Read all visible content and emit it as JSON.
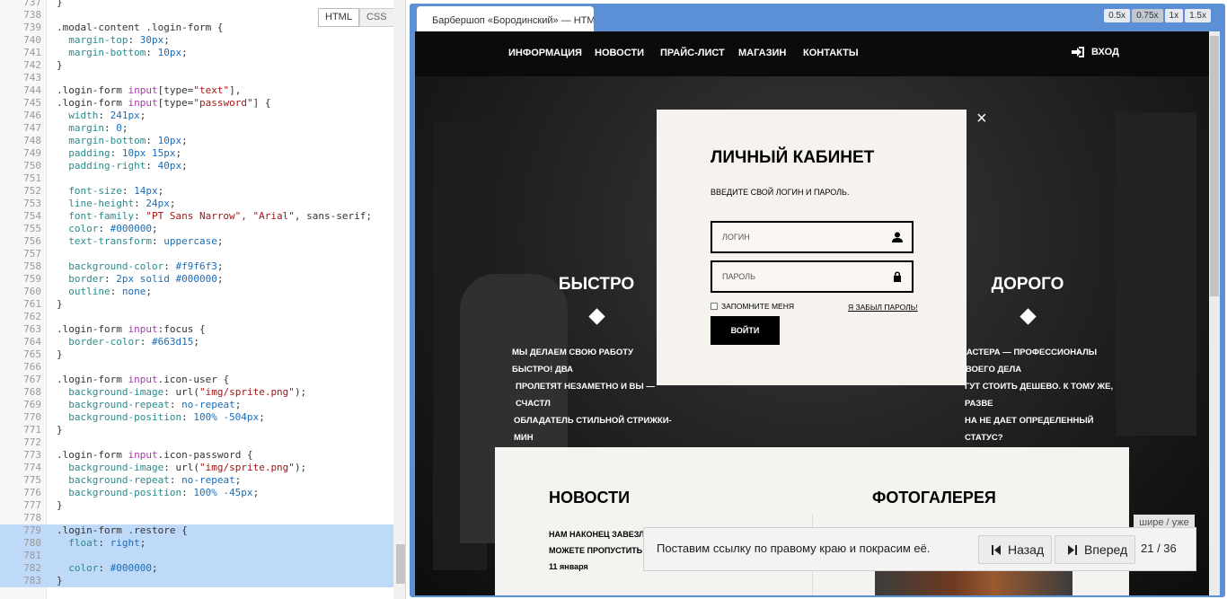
{
  "editor": {
    "toggle": {
      "html": "HTML",
      "css": "CSS"
    },
    "lines": [
      {
        "n": "737",
        "segs": [
          [
            "}",
            "t-sel"
          ]
        ]
      },
      {
        "n": "738",
        "segs": []
      },
      {
        "n": "739",
        "segs": [
          [
            ".modal-content .login-form {",
            "t-sel"
          ]
        ]
      },
      {
        "n": "740",
        "segs": [
          [
            "  margin-top",
            "t-prop"
          ],
          [
            ": ",
            "t-sel"
          ],
          [
            "30px",
            "t-num"
          ],
          [
            ";",
            "t-sel"
          ]
        ]
      },
      {
        "n": "741",
        "segs": [
          [
            "  margin-bottom",
            "t-prop"
          ],
          [
            ": ",
            "t-sel"
          ],
          [
            "10px",
            "t-num"
          ],
          [
            ";",
            "t-sel"
          ]
        ]
      },
      {
        "n": "742",
        "segs": [
          [
            "}",
            "t-sel"
          ]
        ]
      },
      {
        "n": "743",
        "segs": []
      },
      {
        "n": "744",
        "segs": [
          [
            ".login-form ",
            "t-sel"
          ],
          [
            "input",
            "t-tag"
          ],
          [
            "[type=",
            "t-sel"
          ],
          [
            "\"text\"",
            "t-str"
          ],
          [
            "],",
            "t-sel"
          ]
        ]
      },
      {
        "n": "745",
        "segs": [
          [
            ".login-form ",
            "t-sel"
          ],
          [
            "input",
            "t-tag"
          ],
          [
            "[type=",
            "t-sel"
          ],
          [
            "\"password\"",
            "t-str"
          ],
          [
            "] {",
            "t-sel"
          ]
        ]
      },
      {
        "n": "746",
        "segs": [
          [
            "  width",
            "t-prop"
          ],
          [
            ": ",
            "t-sel"
          ],
          [
            "241px",
            "t-num"
          ],
          [
            ";",
            "t-sel"
          ]
        ]
      },
      {
        "n": "747",
        "segs": [
          [
            "  margin",
            "t-prop"
          ],
          [
            ": ",
            "t-sel"
          ],
          [
            "0",
            "t-num"
          ],
          [
            ";",
            "t-sel"
          ]
        ]
      },
      {
        "n": "748",
        "segs": [
          [
            "  margin-bottom",
            "t-prop"
          ],
          [
            ": ",
            "t-sel"
          ],
          [
            "10px",
            "t-num"
          ],
          [
            ";",
            "t-sel"
          ]
        ]
      },
      {
        "n": "749",
        "segs": [
          [
            "  padding",
            "t-prop"
          ],
          [
            ": ",
            "t-sel"
          ],
          [
            "10px 15px",
            "t-num"
          ],
          [
            ";",
            "t-sel"
          ]
        ]
      },
      {
        "n": "750",
        "segs": [
          [
            "  padding-right",
            "t-prop"
          ],
          [
            ": ",
            "t-sel"
          ],
          [
            "40px",
            "t-num"
          ],
          [
            ";",
            "t-sel"
          ]
        ]
      },
      {
        "n": "751",
        "segs": []
      },
      {
        "n": "752",
        "segs": [
          [
            "  font-size",
            "t-prop"
          ],
          [
            ": ",
            "t-sel"
          ],
          [
            "14px",
            "t-num"
          ],
          [
            ";",
            "t-sel"
          ]
        ]
      },
      {
        "n": "753",
        "segs": [
          [
            "  line-height",
            "t-prop"
          ],
          [
            ": ",
            "t-sel"
          ],
          [
            "24px",
            "t-num"
          ],
          [
            ";",
            "t-sel"
          ]
        ]
      },
      {
        "n": "754",
        "segs": [
          [
            "  font-family",
            "t-prop"
          ],
          [
            ": ",
            "t-sel"
          ],
          [
            "\"PT Sans Narrow\", \"Arial\"",
            "t-str"
          ],
          [
            ", sans-serif;",
            "t-sel"
          ]
        ]
      },
      {
        "n": "755",
        "segs": [
          [
            "  color",
            "t-prop"
          ],
          [
            ": ",
            "t-sel"
          ],
          [
            "#000000",
            "t-num"
          ],
          [
            ";",
            "t-sel"
          ]
        ]
      },
      {
        "n": "756",
        "segs": [
          [
            "  text-transform",
            "t-prop"
          ],
          [
            ": ",
            "t-sel"
          ],
          [
            "uppercase",
            "t-kw"
          ],
          [
            ";",
            "t-sel"
          ]
        ]
      },
      {
        "n": "757",
        "segs": []
      },
      {
        "n": "758",
        "segs": [
          [
            "  background-color",
            "t-prop"
          ],
          [
            ": ",
            "t-sel"
          ],
          [
            "#f9f6f3",
            "t-num"
          ],
          [
            ";",
            "t-sel"
          ]
        ]
      },
      {
        "n": "759",
        "segs": [
          [
            "  border",
            "t-prop"
          ],
          [
            ": ",
            "t-sel"
          ],
          [
            "2px solid #000000",
            "t-num"
          ],
          [
            ";",
            "t-sel"
          ]
        ]
      },
      {
        "n": "760",
        "segs": [
          [
            "  outline",
            "t-prop"
          ],
          [
            ": ",
            "t-sel"
          ],
          [
            "none",
            "t-kw"
          ],
          [
            ";",
            "t-sel"
          ]
        ]
      },
      {
        "n": "761",
        "segs": [
          [
            "}",
            "t-sel"
          ]
        ]
      },
      {
        "n": "762",
        "segs": []
      },
      {
        "n": "763",
        "segs": [
          [
            ".login-form ",
            "t-sel"
          ],
          [
            "input",
            "t-tag"
          ],
          [
            ":focus {",
            "t-sel"
          ]
        ]
      },
      {
        "n": "764",
        "segs": [
          [
            "  border-color",
            "t-prop"
          ],
          [
            ": ",
            "t-sel"
          ],
          [
            "#663d15",
            "t-num"
          ],
          [
            ";",
            "t-sel"
          ]
        ]
      },
      {
        "n": "765",
        "segs": [
          [
            "}",
            "t-sel"
          ]
        ]
      },
      {
        "n": "766",
        "segs": []
      },
      {
        "n": "767",
        "segs": [
          [
            ".login-form ",
            "t-sel"
          ],
          [
            "input",
            "t-tag"
          ],
          [
            ".icon-user {",
            "t-sel"
          ]
        ]
      },
      {
        "n": "768",
        "segs": [
          [
            "  background-image",
            "t-prop"
          ],
          [
            ": url(",
            "t-sel"
          ],
          [
            "\"img/sprite.png\"",
            "t-str"
          ],
          [
            ");",
            "t-sel"
          ]
        ]
      },
      {
        "n": "769",
        "segs": [
          [
            "  background-repeat",
            "t-prop"
          ],
          [
            ": ",
            "t-sel"
          ],
          [
            "no-repeat",
            "t-kw"
          ],
          [
            ";",
            "t-sel"
          ]
        ]
      },
      {
        "n": "770",
        "segs": [
          [
            "  background-position",
            "t-prop"
          ],
          [
            ": ",
            "t-sel"
          ],
          [
            "100% -504px",
            "t-num"
          ],
          [
            ";",
            "t-sel"
          ]
        ]
      },
      {
        "n": "771",
        "segs": [
          [
            "}",
            "t-sel"
          ]
        ]
      },
      {
        "n": "772",
        "segs": []
      },
      {
        "n": "773",
        "segs": [
          [
            ".login-form ",
            "t-sel"
          ],
          [
            "input",
            "t-tag"
          ],
          [
            ".icon-password {",
            "t-sel"
          ]
        ]
      },
      {
        "n": "774",
        "segs": [
          [
            "  background-image",
            "t-prop"
          ],
          [
            ": url(",
            "t-sel"
          ],
          [
            "\"img/sprite.png\"",
            "t-str"
          ],
          [
            ");",
            "t-sel"
          ]
        ]
      },
      {
        "n": "775",
        "segs": [
          [
            "  background-repeat",
            "t-prop"
          ],
          [
            ": ",
            "t-sel"
          ],
          [
            "no-repeat",
            "t-kw"
          ],
          [
            ";",
            "t-sel"
          ]
        ]
      },
      {
        "n": "776",
        "segs": [
          [
            "  background-position",
            "t-prop"
          ],
          [
            ": ",
            "t-sel"
          ],
          [
            "100% -45px",
            "t-num"
          ],
          [
            ";",
            "t-sel"
          ]
        ]
      },
      {
        "n": "777",
        "segs": [
          [
            "}",
            "t-sel"
          ]
        ]
      },
      {
        "n": "778",
        "segs": []
      },
      {
        "n": "779",
        "segs": [
          [
            ".login-form .restore {",
            "t-sel"
          ]
        ],
        "hl": true
      },
      {
        "n": "780",
        "segs": [
          [
            "  float",
            "t-prop"
          ],
          [
            ": ",
            "t-sel"
          ],
          [
            "right",
            "t-kw"
          ],
          [
            ";",
            "t-sel"
          ]
        ],
        "hl": true
      },
      {
        "n": "781",
        "segs": [],
        "hl": true
      },
      {
        "n": "782",
        "segs": [
          [
            "  color",
            "t-prop"
          ],
          [
            ": ",
            "t-sel"
          ],
          [
            "#000000",
            "t-num"
          ],
          [
            ";",
            "t-sel"
          ]
        ],
        "hl": true
      },
      {
        "n": "783",
        "segs": [
          [
            "}",
            "t-sel"
          ]
        ],
        "hl": true
      }
    ]
  },
  "preview": {
    "tab_title": "Барбершоп «Бородинский» — HTML",
    "zoom": [
      "0.5x",
      "0.75x",
      "1x",
      "1.5x"
    ],
    "zoom_active": "0.75x"
  },
  "site": {
    "nav": [
      "ИНФОРМАЦИЯ",
      "НОВОСТИ",
      "ПРАЙС-ЛИСТ",
      "МАГАЗИН",
      "КОНТАКТЫ"
    ],
    "login": "ВХОД",
    "features": {
      "left_title": "БЫСТРО",
      "right_title": "ДОРОГО",
      "left_text": [
        "МЫ ДЕЛАЕМ СВОЮ РАБОТУ БЫСТРО! ДВА",
        "ПРОЛЕТЯТ НЕЗАМЕТНО И ВЫ — СЧАСТЛ",
        "ОБЛАДАТЕЛЬ СТИЛЬНОЙ СТРИЖКИ-МИН"
      ],
      "right_text": [
        "МАСТЕРА — ПРОФЕССИОНАЛЫ СВОЕГО ДЕЛА",
        "ГУТ СТОИТЬ ДЕШЕВО. К ТОМУ ЖЕ, РАЗВЕ",
        "НА НЕ ДАЕТ ОПРЕДЕЛЕННЫЙ СТАТУС?"
      ]
    },
    "news": {
      "title": "НОВОСТИ",
      "text": "НАМ НАКОНЕЦ ЗАВЕЗЛИ ЯГЕРМАЙСТЕР! ТЕПЕРЬ ВЫ МОЖЕТЕ ПРОПУСТИТЬ СТАКАНЧИК В",
      "date": "11 января"
    },
    "gallery": {
      "title": "ФОТОГАЛЕРЕЯ"
    }
  },
  "modal": {
    "title": "ЛИЧНЫЙ КАБИНЕТ",
    "subtitle": "ВВЕДИТЕ СВОЙ ЛОГИН И ПАРОЛЬ.",
    "login_placeholder": "ЛОГИН",
    "password_placeholder": "ПАРОЛЬ",
    "remember": "ЗАПОМНИТЕ МЕНЯ",
    "forgot": "Я ЗАБЫЛ ПАРОЛЬ!",
    "submit": "ВОЙТИ",
    "close": "×"
  },
  "tutorial": {
    "hint_label": "шире / уже",
    "text": "Поставим ссылку по правому краю и покрасим её.",
    "back": "Назад",
    "forward": "Вперед",
    "counter": "21 / 36"
  }
}
